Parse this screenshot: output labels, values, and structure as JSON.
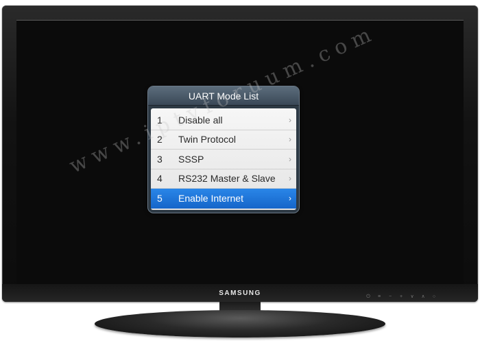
{
  "tv": {
    "brand": "SAMSUNG",
    "control_icons": [
      "power-icon",
      "menu-icon",
      "volume-minus-icon",
      "volume-plus-icon",
      "channel-down-icon",
      "channel-up-icon",
      "source-icon"
    ]
  },
  "menu": {
    "title": "UART Mode List",
    "items": [
      {
        "number": "1",
        "label": "Disable all",
        "selected": false
      },
      {
        "number": "2",
        "label": "Twin Protocol",
        "selected": false
      },
      {
        "number": "3",
        "label": "SSSP",
        "selected": false
      },
      {
        "number": "4",
        "label": "RS232 Master & Slave",
        "selected": false
      },
      {
        "number": "5",
        "label": "Enable Internet",
        "selected": true
      }
    ],
    "chevron": "›"
  },
  "watermark": "www.iptvforuum.com",
  "colors": {
    "selection": "#1e74dc",
    "title_bar": "#4a5a6a",
    "list_background": "#eeeeee"
  }
}
